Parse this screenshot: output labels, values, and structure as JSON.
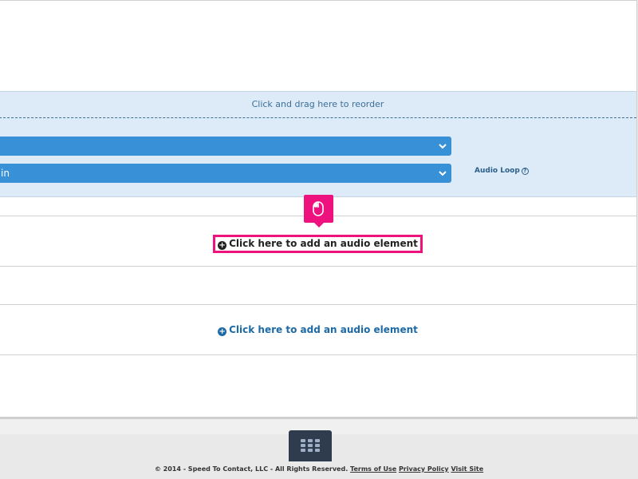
{
  "reorder": {
    "drag_hint": "Click and drag here to reorder",
    "select_1_value": "",
    "select_2_value": "in",
    "audio_loop_label": "Audio Loop",
    "help_glyph": "?"
  },
  "audio_elements": [
    {
      "add_label": "Click here to add an audio element",
      "highlighted": true
    },
    {
      "add_label": "Click here to add an audio element",
      "highlighted": false
    }
  ],
  "icons": {
    "plus": "+",
    "select_chevron": "chevron-down-icon",
    "tooltip": "mouse-icon",
    "grid_button": "grid-icon"
  },
  "colors": {
    "accent_blue": "#3890d6",
    "highlight_pink": "#ee127e",
    "reorder_bg": "#dcebf7",
    "link_blue": "#1d6aa6",
    "footer_button": "#2f3c4e"
  },
  "footer": {
    "copyright": "© 2014 - Speed To Contact, LLC - All Rights Reserved.",
    "terms_link": "Terms of Use",
    "privacy_link": "Privacy Policy",
    "visit_link": "Visit Site"
  }
}
